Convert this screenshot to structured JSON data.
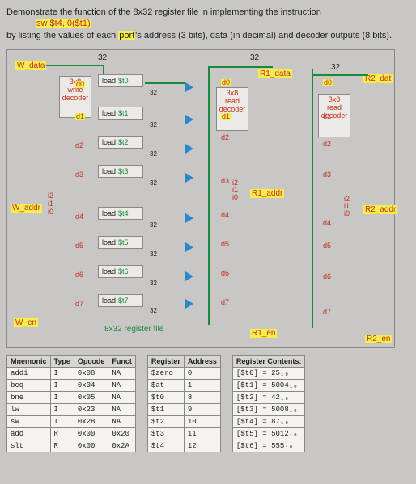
{
  "question": {
    "line1": "Demonstrate the function of the 8x32 register file in implementing the instruction",
    "instr": "sw $t4, 0($t1)",
    "line2_a": "by listing the values of each ",
    "line2_hl": "port",
    "line2_b": "'s address (3 bits), data (in decimal) and decoder outputs (8 bits)."
  },
  "diagram": {
    "w_data": "W_data",
    "w_addr": "W_addr",
    "w_en": "W_en",
    "r1_data": "R1_data",
    "r1_addr": "R1_addr",
    "r1_en": "R1_en",
    "r2_data": "R2_dat",
    "r2_addr": "R2_addr",
    "r2_en": "R2_en",
    "write_dec": "3x8 write decoder",
    "read_dec1": "3x8 read decoder",
    "read_dec2": "3x8 read decoder",
    "bits_i": [
      "i2",
      "i1",
      "i0"
    ],
    "bus32": "32",
    "regfile_lbl": "8x32 register file",
    "d": [
      "d0",
      "d1",
      "d2",
      "d3",
      "d4",
      "d5",
      "d6",
      "d7"
    ],
    "regs": [
      "$t0",
      "$t1",
      "$t2",
      "$t3",
      "$t4",
      "$t5",
      "$t6",
      "$t7"
    ],
    "load": "load"
  },
  "tables": {
    "instr": {
      "headers": [
        "Mnemonic",
        "Type",
        "Opcode",
        "Funct"
      ],
      "rows": [
        [
          "addi",
          "I",
          "0x08",
          "NA"
        ],
        [
          "beq",
          "I",
          "0x04",
          "NA"
        ],
        [
          "bne",
          "I",
          "0x05",
          "NA"
        ],
        [
          "lw",
          "I",
          "0x23",
          "NA"
        ],
        [
          "sw",
          "I",
          "0x2B",
          "NA"
        ],
        [
          "add",
          "R",
          "0x00",
          "0x20"
        ],
        [
          "slt",
          "R",
          "0x00",
          "0x2A"
        ]
      ]
    },
    "regaddr": {
      "headers": [
        "Register",
        "Address"
      ],
      "rows": [
        [
          "$zero",
          "0"
        ],
        [
          "$at",
          "1"
        ],
        [
          "$t0",
          "8"
        ],
        [
          "$t1",
          "9"
        ],
        [
          "$t2",
          "10"
        ],
        [
          "$t3",
          "11"
        ],
        [
          "$t4",
          "12"
        ]
      ]
    },
    "contents": {
      "header": "Register Contents:",
      "rows": [
        "[$t0] = 25₁₀",
        "[$t1] = 5004₁₀",
        "[$t2] = 42₁₀",
        "[$t3] = 5008₁₀",
        "[$t4] = 87₁₀",
        "[$t5] = 5012₁₀",
        "[$t6] = 555₁₀"
      ]
    }
  }
}
